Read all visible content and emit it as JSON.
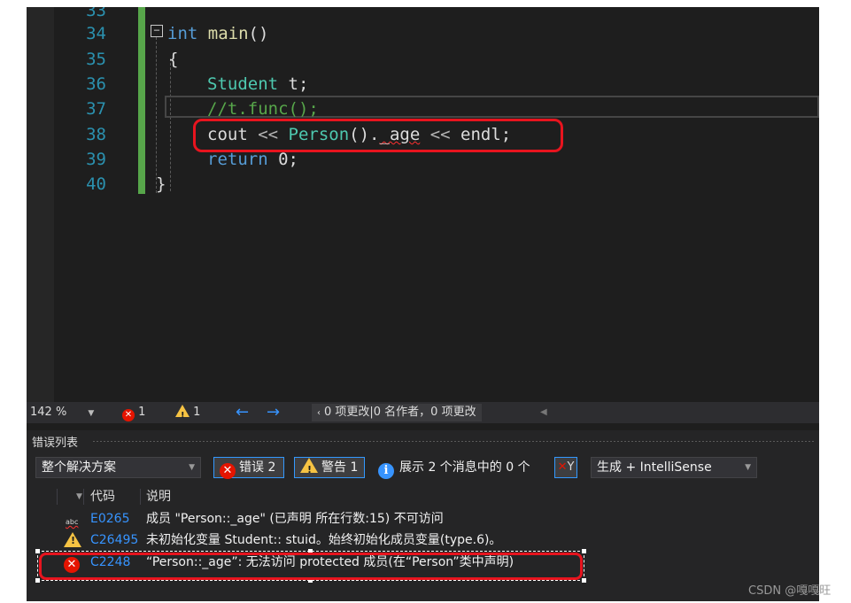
{
  "editor": {
    "lines": [
      {
        "num": "33"
      },
      {
        "num": "34"
      },
      {
        "num": "35"
      },
      {
        "num": "36"
      },
      {
        "num": "37"
      },
      {
        "num": "38"
      },
      {
        "num": "39"
      },
      {
        "num": "40"
      }
    ],
    "code": {
      "l34_kw": "int",
      "l34_fn": " main",
      "l34_rest": "()",
      "l35": "{",
      "l36_ty": "Student",
      "l36_rest": " t;",
      "l37_comment": "//t.func();",
      "l38_a": "cout ",
      "l38_op1": "<<",
      "l38_ty": " Person",
      "l38_b": "().",
      "l38_member": "_age",
      "l38_op2": " <<",
      "l38_c": " endl;",
      "l39_kw": "return",
      "l39_rest": " 0;",
      "l40": "}"
    },
    "collapse_glyph": "−"
  },
  "status": {
    "zoom": "142 %",
    "errors": "1",
    "warnings": "1",
    "back_arrow": "←",
    "forward_arrow": "→",
    "changes": "0 项更改|0 名作者，0 项更改"
  },
  "error_list": {
    "title": "错误列表",
    "scope": "整个解决方案",
    "errors_label": "错误 2",
    "warnings_label": "警告 1",
    "messages_label": "展示 2 个消息中的 0 个",
    "source": "生成 + IntelliSense",
    "headers": {
      "code": "代码",
      "description": "说明"
    },
    "rows": [
      {
        "icon": "abc",
        "code": "E0265",
        "description": "成员 \"Person::_age\" (已声明 所在行数:15) 不可访问"
      },
      {
        "icon": "warning",
        "code": "C26495",
        "description": "未初始化变量 Student:: stuid。始终初始化成员变量(type.6)。"
      },
      {
        "icon": "error",
        "code": "C2248",
        "description": "“Person::_age”: 无法访问 protected 成员(在“Person”类中声明)"
      }
    ]
  },
  "watermark": "CSDN @嘎嘎旺",
  "colors": {
    "editor_bg": "#1e1e1e",
    "keyword": "#569cd6",
    "type": "#4ec9b0",
    "comment": "#57a64a",
    "line_number": "#2b91af",
    "annotation_red": "#e8141e"
  }
}
